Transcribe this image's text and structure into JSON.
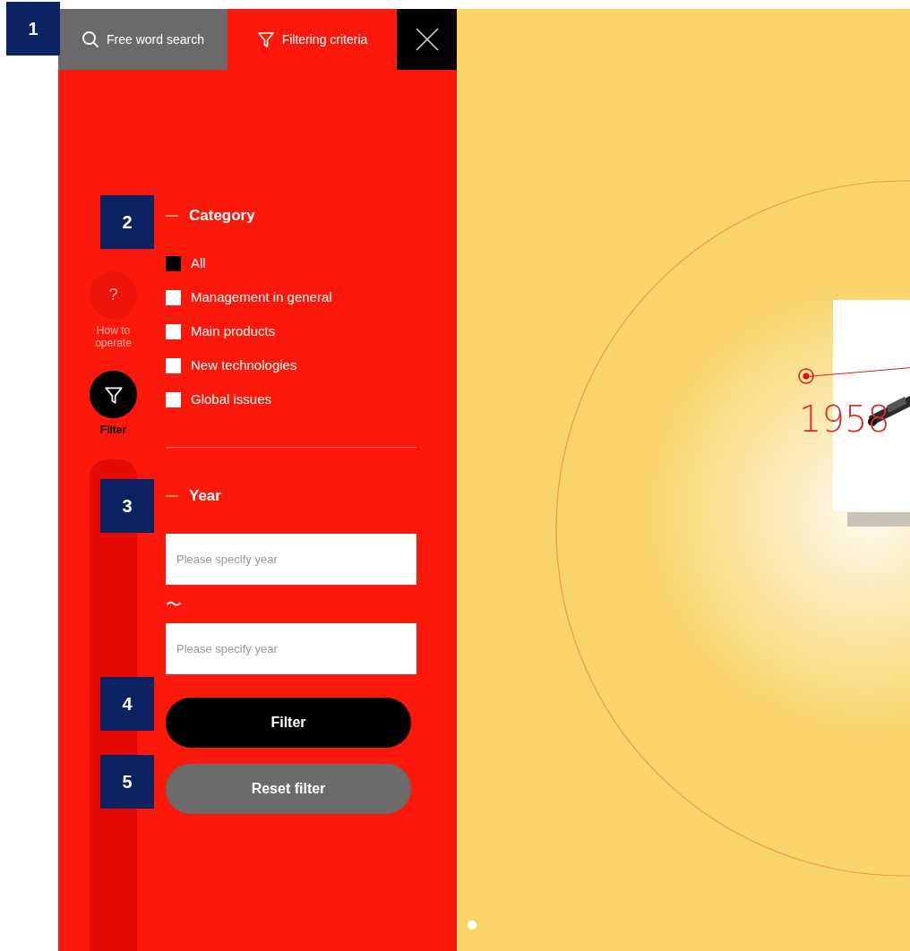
{
  "tabs": [
    {
      "label": "Free word search",
      "selected": false
    },
    {
      "label": "Filtering criteria",
      "selected": true
    }
  ],
  "rail": [
    {
      "kind": "help",
      "glyph": "?",
      "label": "How to operate",
      "selected": false
    },
    {
      "kind": "filter",
      "label": "Filter",
      "selected": true
    }
  ],
  "category": {
    "title": "Category",
    "items": [
      {
        "label": "All",
        "checked": true
      },
      {
        "label": "Management in general",
        "checked": false
      },
      {
        "label": "Main products",
        "checked": false
      },
      {
        "label": "New technologies",
        "checked": false
      },
      {
        "label": "Global issues",
        "checked": false
      }
    ]
  },
  "year": {
    "title": "Year",
    "fields": [
      {
        "placeholder": "Please specify year"
      },
      {
        "placeholder": "Please specify year"
      }
    ],
    "separator": "〜"
  },
  "buttons": [
    {
      "label": "Filter",
      "kind": "primary"
    },
    {
      "label": "Reset filter",
      "kind": "secondary"
    }
  ],
  "timeline": {
    "year": "1958"
  },
  "callouts": [
    "1",
    "2",
    "3",
    "4",
    "5"
  ]
}
